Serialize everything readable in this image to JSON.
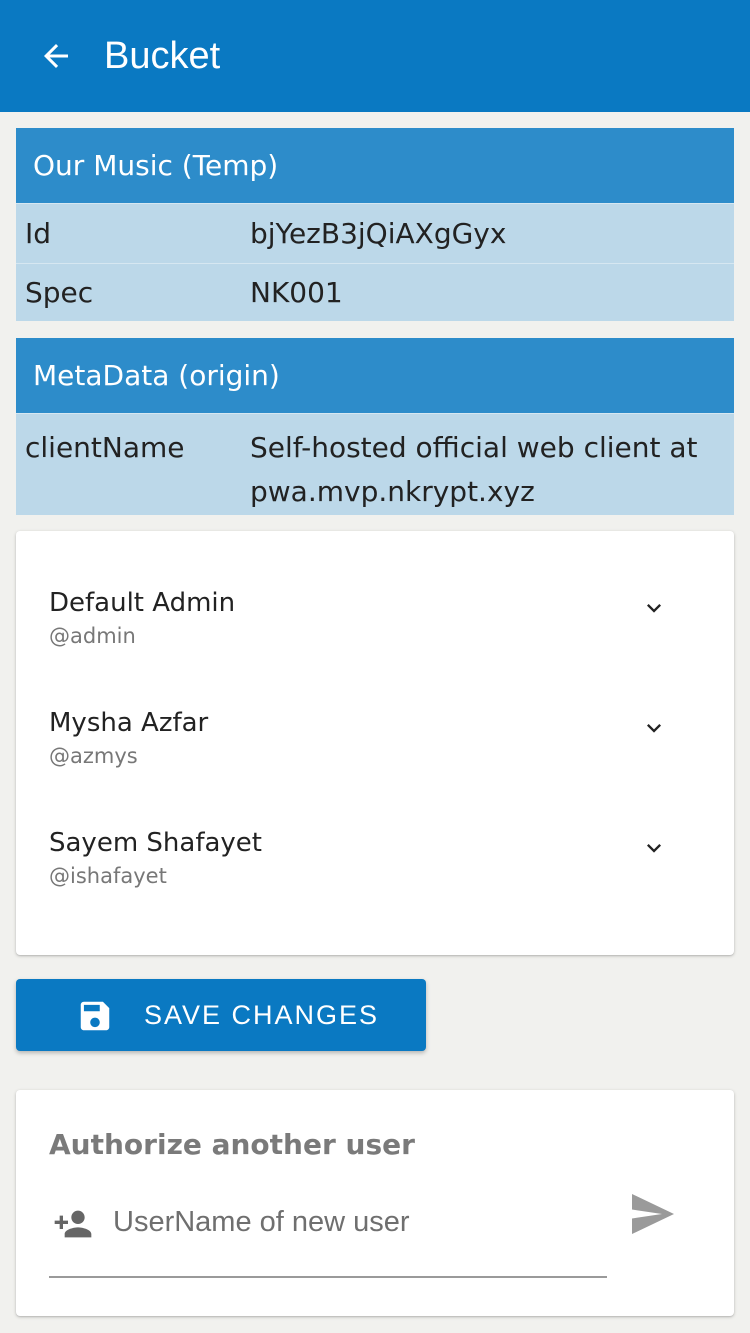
{
  "appbar": {
    "title": "Bucket",
    "back_icon": "arrow-left-icon",
    "color": "#0a79c2"
  },
  "bucket_info": {
    "header": "Our Music (Temp)",
    "rows": [
      {
        "key": "Id",
        "value": "bjYezB3jQiAXgGyx"
      },
      {
        "key": "Spec",
        "value": "NK001"
      }
    ]
  },
  "metadata": {
    "header": "MetaData (origin)",
    "rows": [
      {
        "key": "clientName",
        "value": "Self-hosted official web client at pwa.mvp.nkrypt.xyz"
      }
    ]
  },
  "users": [
    {
      "name": "Default Admin",
      "handle": "@admin",
      "icon": "chevron-down-icon"
    },
    {
      "name": "Mysha Azfar",
      "handle": "@azmys",
      "icon": "chevron-down-icon"
    },
    {
      "name": "Sayem Shafayet",
      "handle": "@ishafayet",
      "icon": "chevron-down-icon"
    }
  ],
  "save_button": {
    "label": "SAVE CHANGES",
    "icon": "floppy-disk-icon"
  },
  "authorize": {
    "title": "Authorize another user",
    "input_value": "",
    "placeholder": "UserName of new user",
    "input_icon": "person-add-icon",
    "send_icon": "send-icon"
  },
  "colors": {
    "primary": "#0a79c2",
    "table_header": "#2d8cca",
    "table_body": "#bcd8e9",
    "background": "#f1f1ee"
  }
}
